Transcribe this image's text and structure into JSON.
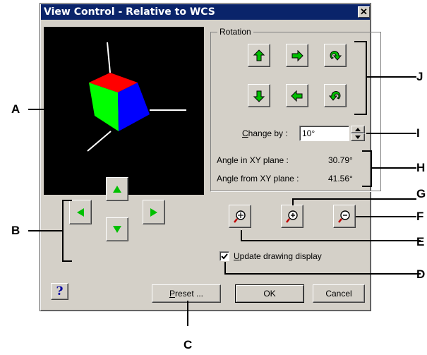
{
  "dialog": {
    "title": "View Control - Relative to WCS",
    "close_glyph": "✕"
  },
  "rotation": {
    "group_label": "Rotation",
    "buttons_top": [
      "rotate-up-icon",
      "rotate-horizontal-icon",
      "rotate-clockwise-icon"
    ],
    "buttons_bottom": [
      "rotate-down-icon",
      "rotate-horizontal-reverse-icon",
      "rotate-counterclockwise-icon"
    ]
  },
  "change_by": {
    "label_u": "C",
    "label_rest": "hange by :",
    "value": "10°"
  },
  "angles": {
    "xy_label": "Angle in XY plane :",
    "xy_value": "30.79°",
    "from_label": "Angle from XY plane :",
    "from_value": "41.56°"
  },
  "update": {
    "checked": true,
    "label_u": "U",
    "label_rest": "pdate drawing display"
  },
  "buttons": {
    "help": "?",
    "preset_u": "P",
    "preset_rest": "reset ...",
    "ok": "OK",
    "cancel": "Cancel"
  },
  "callouts": [
    "A",
    "B",
    "C",
    "D",
    "E",
    "F",
    "G",
    "H",
    "I",
    "J"
  ],
  "colors": {
    "title_bar": "#0a246a",
    "dialog_bg": "#d4d0c8",
    "arrow_green": "#00c000",
    "cube_red": "#ff0000",
    "cube_green": "#00ff00",
    "cube_blue": "#0000ff"
  }
}
